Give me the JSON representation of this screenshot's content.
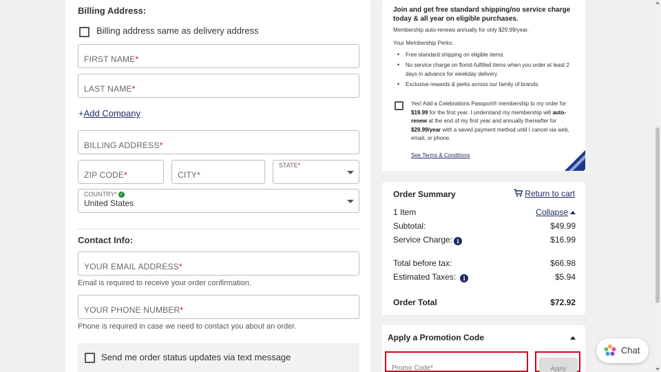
{
  "billing": {
    "title": "Billing Address:",
    "same_as_delivery": "Billing address same as delivery address",
    "first_name": "FIRST NAME",
    "last_name": "LAST NAME",
    "add_company_plus": "+",
    "add_company": "Add Company",
    "address": "BILLING ADDRESS",
    "zip": "ZIP CODE",
    "city": "CITY*",
    "state_label": "STATE",
    "country_label": "COUNTRY*",
    "country_value": "United States",
    "required_mark": "*"
  },
  "contact": {
    "title": "Contact Info:",
    "email": "YOUR EMAIL ADDRESS",
    "email_help": "Email is required to receive your order confirmation.",
    "phone": "YOUR PHONE NUMBER",
    "phone_help": "Phone is required in case we need to contact you about an order.",
    "sms": "Send me order status updates via text message"
  },
  "membership": {
    "headline": "Join and get free standard shipping/no service charge today & all year on eligible purchases.",
    "renew_note": "Membership auto-renews annually for only $29.99/year.",
    "perks_title": "Your Membership Perks:",
    "perks": [
      "Free standard shipping on eligible items.",
      "No service charge on florist-fulfilled items when you order at least 2 days in advance for weekday delivery.",
      "Exclusive rewards & perks across our family of brands."
    ],
    "yes_1": "Yes! Add a Celebrations Passport® membership to my order for ",
    "yes_price1": "$19.99",
    "yes_2": " for the first year. I understand my membership will ",
    "yes_autorenew": "auto-renew",
    "yes_3": " at the end of my first year and annually thereafter for ",
    "yes_price2": "$29.99/year",
    "yes_4": " with a saved payment method until I cancel via web, email, or phone.",
    "terms": "See Terms & Conditions"
  },
  "order_summary": {
    "title": "Order Summary",
    "return_to_cart": "Return to cart",
    "items": "1 Item",
    "collapse": "Collapse",
    "subtotal_label": "Subtotal:",
    "subtotal": "$49.99",
    "service_label": "Service Charge:",
    "service": "$16.99",
    "before_tax_label": "Total before tax:",
    "before_tax": "$66.98",
    "taxes_label": "Estimated Taxes:",
    "taxes": "$5.94",
    "total_label": "Order Total",
    "total": "$72.92",
    "info_glyph": "i"
  },
  "promo": {
    "title": "Apply a Promotion Code",
    "placeholder": "Promo Code*",
    "apply": "Apply"
  },
  "chat": {
    "label": "Chat"
  },
  "colors": {
    "accent": "#1d2b63",
    "required": "#c8102e",
    "highlight": "#d0021b",
    "success": "#1e8e3e"
  }
}
